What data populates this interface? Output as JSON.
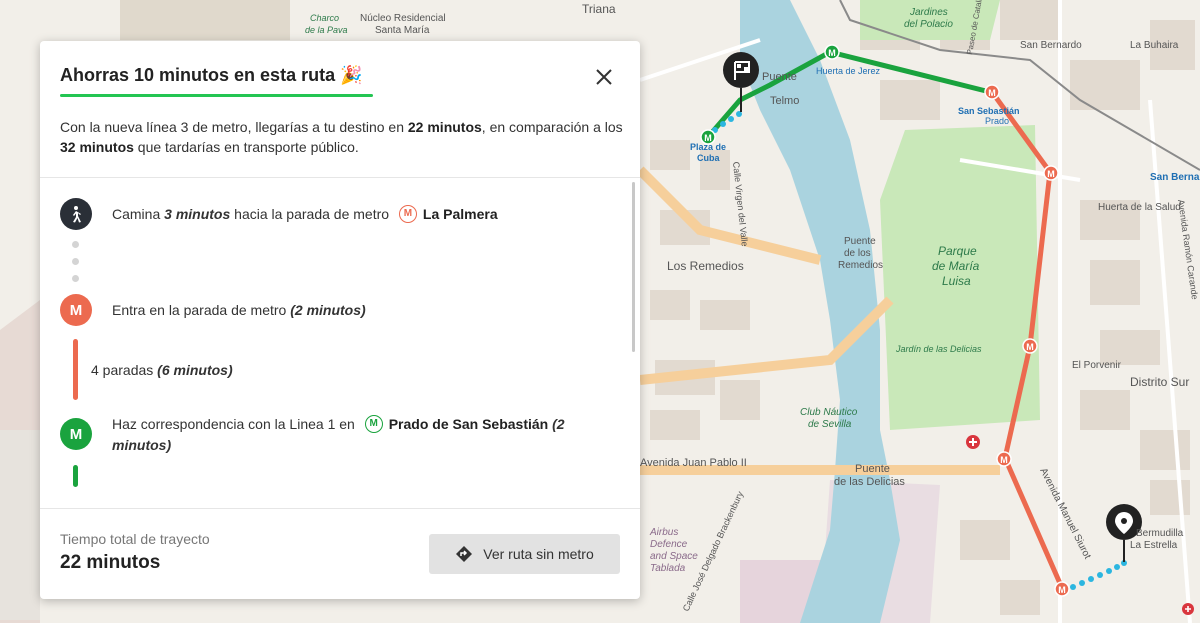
{
  "map": {
    "labels": {
      "nucleo": "Núcleo Residencial",
      "santa_maria": "Santa María",
      "charco": "Charco",
      "de_la_pava": "de la Pava",
      "triana": "Triana",
      "jardines": "Jardines",
      "del_polacio": "del Polacio",
      "san_bernardo": "San Bernardo",
      "la_buhaira": "La Buhaira",
      "puente": "Puente",
      "san_telmo": "Telmo",
      "huerta_jerez": "Huerta de Jerez",
      "plaza_cuba_1": "Plaza de",
      "plaza_cuba_2": "Cuba",
      "prado_1": "Prado",
      "prado_2": "San Sebastián",
      "san_bernardo_2": "San Berna",
      "huerta_salud": "Huerta de la Salud",
      "los_remedios": "Los Remedios",
      "puente_remedios_1": "Puente",
      "puente_remedios_2": "de los",
      "puente_remedios_3": "Remedios",
      "parque_1": "Parque",
      "parque_2": "de María",
      "parque_3": "Luisa",
      "jardin_delicias": "Jardín de las Delicias",
      "club_nautico_1": "Club Náutico",
      "club_nautico_2": "de Sevilla",
      "avenida_juan_pablo": "Avenida Juan Pablo II",
      "puente_delicias_1": "Puente",
      "puente_delicias_2": "de las Delicias",
      "distrito_sur": "Distrito Sur",
      "el_porvenir": "El Porvenir",
      "avenida_manuel_siurot": "Avenida Manuel Siurot",
      "airbus_1": "Airbus",
      "airbus_2": "Defence",
      "airbus_3": "and Space",
      "airbus_4": "Tablada",
      "calle_delgado": "Calle José Delgado Brackenbury",
      "heliopolis_1": "Bermudilla",
      "heliopolis_2": "La Estrella",
      "calle_virgen_valle": "Calle Virgen del Valle",
      "avenida_ramon_carande": "Avenida Ramón Carande",
      "paseo_catalina": "Paseo de Catalina"
    },
    "metro_letter": "M"
  },
  "panel": {
    "title": "Ahorras 10 minutos en esta ruta",
    "title_emoji": "🎉",
    "description": {
      "p1": "Con la nueva línea 3 de metro, llegarías a tu destino en ",
      "b1": "22 minutos",
      "p2": ", en comparación a los ",
      "b2": "32 minutos",
      "p3": " que tardarías en transporte público."
    },
    "steps": {
      "walk": {
        "prefix": "Camina ",
        "duration": "3 minutos",
        "mid": " hacia la parada de metro",
        "stop": "La Palmera"
      },
      "enter": {
        "icon_letter": "M",
        "text": "Entra en la parada de metro ",
        "duration": "(2 minutos)"
      },
      "ride": {
        "text": "4 paradas ",
        "duration": "(6 minutos)"
      },
      "transfer": {
        "icon_letter": "M",
        "text": "Haz correspondencia con la Linea 1 en",
        "stop": "Prado de San Sebastián",
        "duration": "(2 minutos)"
      }
    },
    "footer": {
      "total_label": "Tiempo total de trayecto",
      "total_value": "22 minutos",
      "button_label": "Ver ruta sin metro"
    }
  },
  "colors": {
    "line3": "#ec6a4f",
    "line1": "#1aa33e",
    "accent": "#23c552"
  }
}
